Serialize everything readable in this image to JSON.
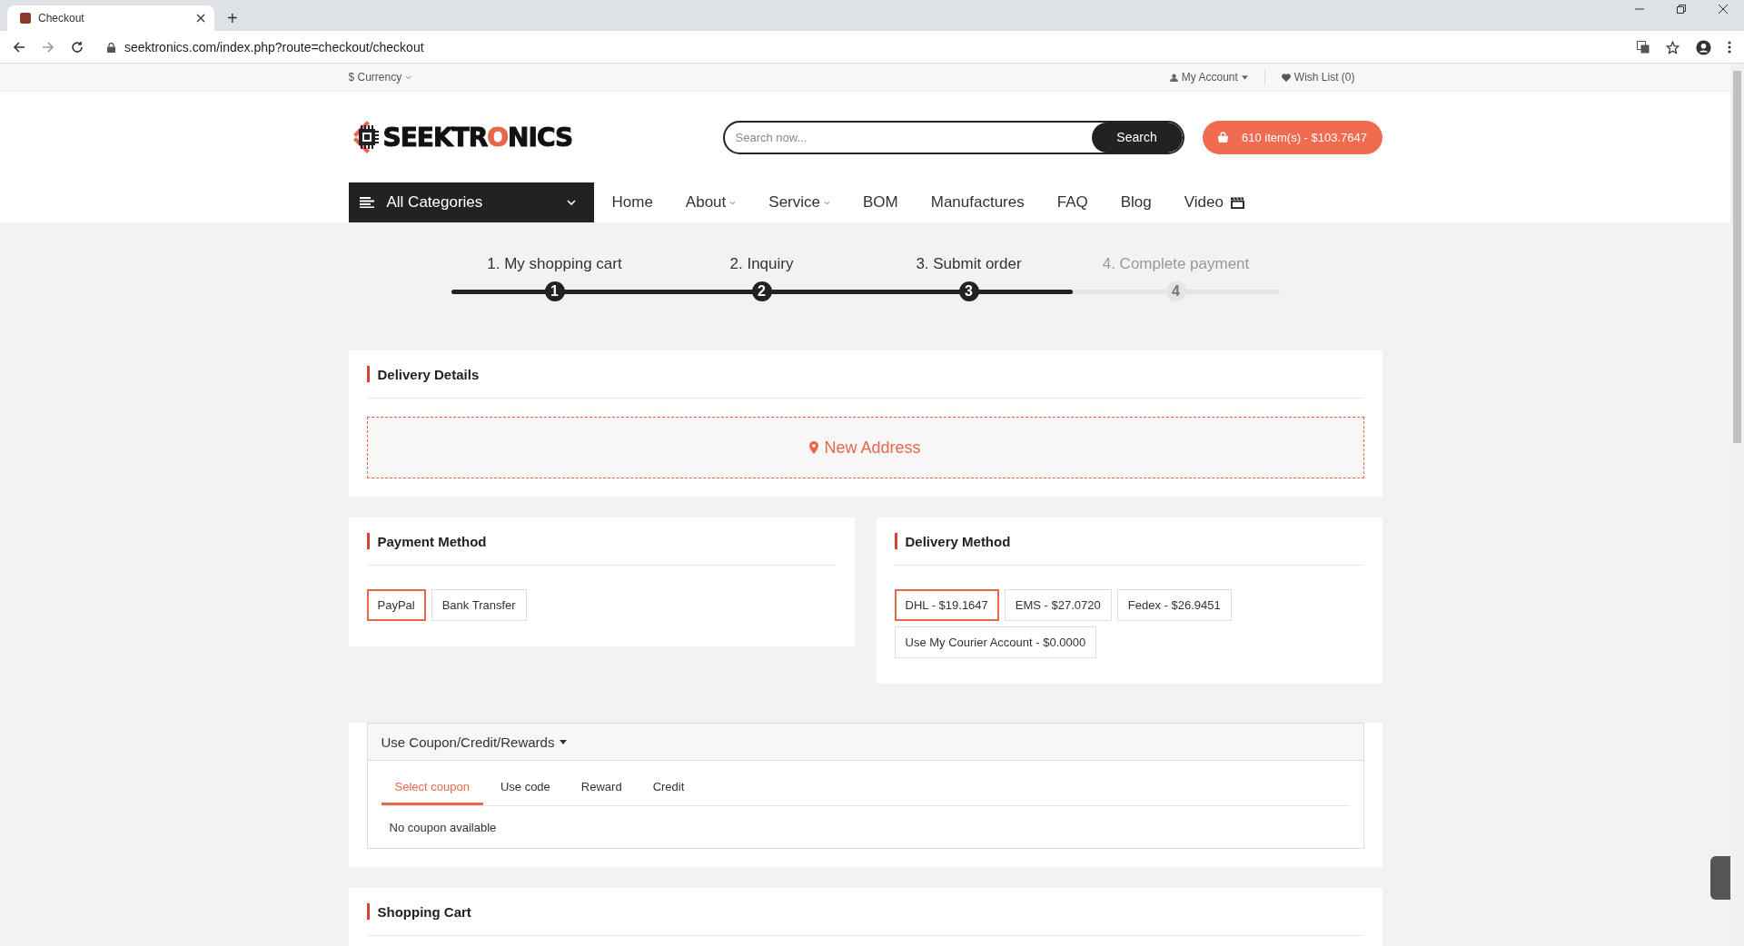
{
  "browser": {
    "tab_title": "Checkout",
    "new_tab": "+",
    "url": "seektronics.com/index.php?route=checkout/checkout"
  },
  "topbar": {
    "currency": "$ Currency",
    "account": "My Account",
    "wishlist": "Wish List (0)"
  },
  "header": {
    "logo": [
      {
        "text": "SEEKTR",
        "accent": false
      },
      {
        "text": "O",
        "accent": true
      },
      {
        "text": "NICS",
        "accent": false
      }
    ],
    "search_placeholder": "Search now...",
    "search_button": "Search",
    "cart": "610 item(s) - $103.7647"
  },
  "nav": {
    "categories": "All Categories",
    "items": [
      {
        "label": "Home",
        "dropdown": false,
        "icon": false
      },
      {
        "label": "About",
        "dropdown": true,
        "icon": false
      },
      {
        "label": "Service",
        "dropdown": true,
        "icon": false
      },
      {
        "label": "BOM",
        "dropdown": false,
        "icon": false
      },
      {
        "label": "Manufactures",
        "dropdown": false,
        "icon": false
      },
      {
        "label": "FAQ",
        "dropdown": false,
        "icon": false
      },
      {
        "label": "Blog",
        "dropdown": false,
        "icon": false
      },
      {
        "label": "Video",
        "dropdown": false,
        "icon": true
      }
    ]
  },
  "steps": {
    "level": 0.75,
    "items": [
      {
        "label": "1. My shopping cart",
        "number": "1",
        "done": true
      },
      {
        "label": "2. Inquiry",
        "number": "2",
        "done": true
      },
      {
        "label": "3. Submit order",
        "number": "3",
        "done": true
      },
      {
        "label": "4. Complete payment",
        "number": "4",
        "done": false
      }
    ]
  },
  "delivery_details": {
    "title": "Delivery Details",
    "new_address": "New Address"
  },
  "payment_method": {
    "title": "Payment Method",
    "options": [
      {
        "label": "PayPal",
        "selected": true
      },
      {
        "label": "Bank Transfer",
        "selected": false
      }
    ]
  },
  "delivery_method": {
    "title": "Delivery Method",
    "options": [
      {
        "label": "DHL - $19.1647",
        "selected": true
      },
      {
        "label": "EMS - $27.0720",
        "selected": false
      },
      {
        "label": "Fedex - $26.9451",
        "selected": false
      },
      {
        "label": "Use My Courier Account - $0.0000",
        "selected": false
      }
    ]
  },
  "coupon": {
    "header": "Use Coupon/Credit/Rewards",
    "tabs": [
      {
        "label": "Select coupon",
        "selected": true
      },
      {
        "label": "Use code",
        "selected": false
      },
      {
        "label": "Reward",
        "selected": false
      },
      {
        "label": "Credit",
        "selected": false
      }
    ],
    "message": "No coupon available"
  },
  "shopping_cart": {
    "title": "Shopping Cart"
  }
}
